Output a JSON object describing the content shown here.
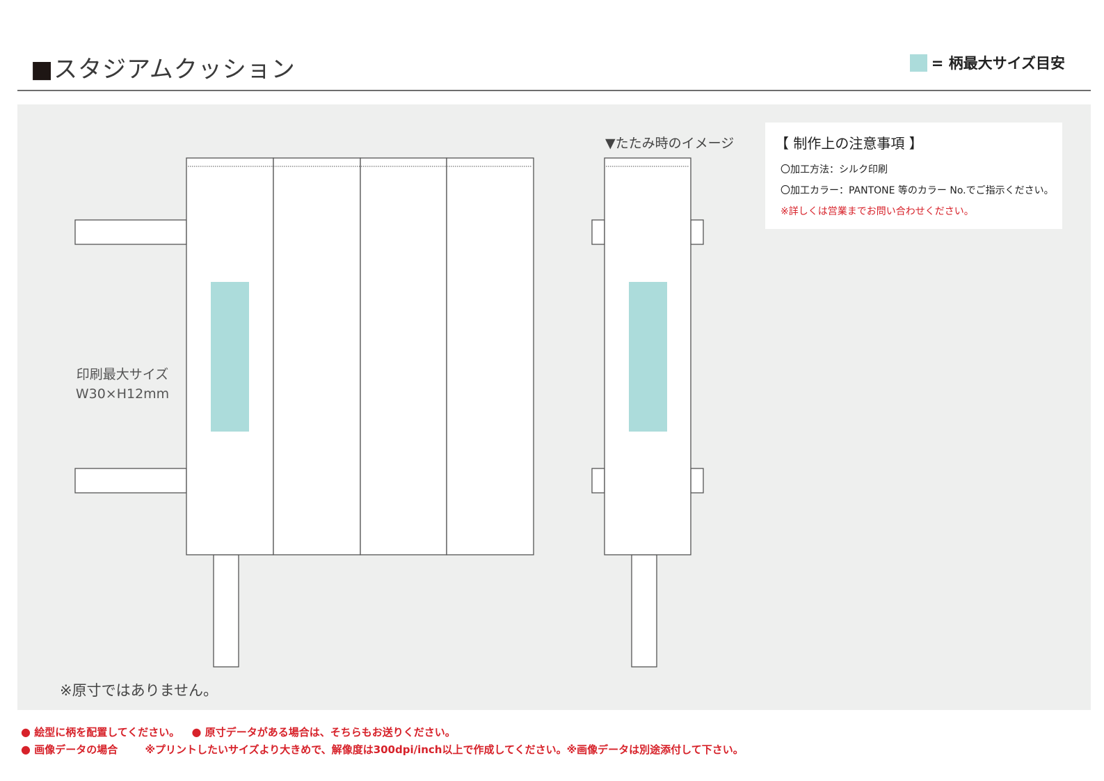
{
  "header": {
    "title_mark": "■",
    "title": "スタジアムクッション",
    "legend_label": "= 柄最大サイズ目安"
  },
  "colors": {
    "print_area": "#acdcdb",
    "panel_background": "#eeefee",
    "accent_red": "#d7222a"
  },
  "drawing": {
    "folded_label": "▼たたみ時のイメージ",
    "print_size_label": "印刷最大サイズ",
    "print_size_value": "W30×H12mm",
    "scale_note": "※原寸ではありません。"
  },
  "notes": {
    "heading": "【 制作上の注意事項 】",
    "method": "〇加工方法：シルク印刷",
    "color": "〇加工カラー：PANTONE 等のカラー No.でご指示ください。",
    "contact": "※詳しくは営業までお問い合わせください。"
  },
  "footer": {
    "bullet": "●",
    "item1": "絵型に柄を配置してください。",
    "item2": "原寸データがある場合は、そちらもお送りください。",
    "item3": "画像データの場合",
    "item3_detail": "※プリントしたいサイズより大きめで、解像度は300dpi/inch以上で作成してください。※画像データは別途添付して下さい。"
  }
}
